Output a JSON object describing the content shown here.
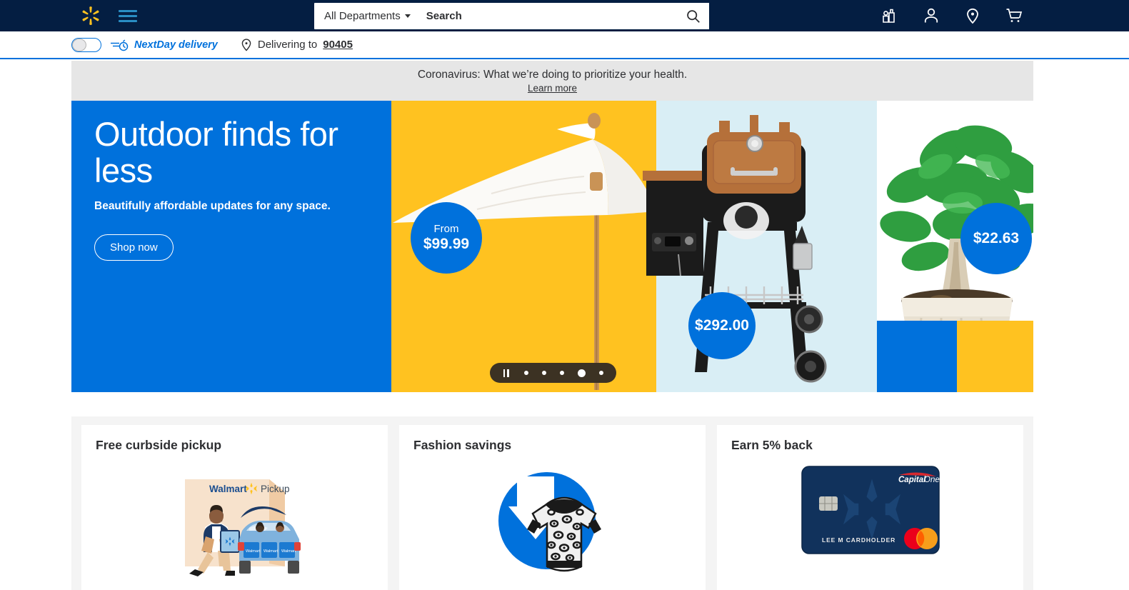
{
  "header": {
    "logo_icon": "walmart-spark-icon",
    "menu_icon": "hamburger-menu-icon",
    "search": {
      "department_label": "All Departments",
      "placeholder": "Search",
      "value": "",
      "search_icon": "search-icon"
    },
    "icons": [
      {
        "name": "grocery-icon",
        "label": "Grocery"
      },
      {
        "name": "account-icon",
        "label": "Account"
      },
      {
        "name": "location-pin-icon",
        "label": "Store location"
      },
      {
        "name": "cart-icon",
        "label": "Cart"
      }
    ]
  },
  "delivery_bar": {
    "toggle_state": "off",
    "toggle_name": "nextday-delivery-toggle",
    "nextday_label": "NextDay delivery",
    "nextday_icon": "nextday-bike-icon",
    "pin_icon": "location-pin-icon",
    "delivering_to_label": "Delivering to",
    "zip": "90405"
  },
  "covid_banner": {
    "message": "Coronavirus: What we’re doing to prioritize your health.",
    "link_label": "Learn more"
  },
  "hero": {
    "headline": "Outdoor finds for less",
    "subhead": "Beautifully affordable updates for any space.",
    "cta_label": "Shop now",
    "price_bubbles": [
      {
        "prefix": "From",
        "price": "$99.99",
        "product": "patio-umbrella"
      },
      {
        "prefix": "",
        "price": "$292.00",
        "product": "pellet-grill"
      },
      {
        "prefix": "",
        "price": "$22.63",
        "product": "potted-plant"
      }
    ],
    "carousel": {
      "pause_icon": "pause-icon",
      "slide_count": 5,
      "active_slide": 4
    },
    "colors": {
      "blue": "#0071dc",
      "yellow": "#ffc220",
      "cyan": "#d9eef5",
      "dark_navy": "#041e42"
    }
  },
  "cards": [
    {
      "title": "Free curbside pickup",
      "art": "walmart-pickup-illustration",
      "sign_brand": "Walmart",
      "sign_word": "Pickup"
    },
    {
      "title": "Fashion savings",
      "art": "leopard-sweater-illustration"
    },
    {
      "title": "Earn 5% back",
      "art": "capital-one-card-illustration",
      "card_brand": "CapitalOne",
      "cardholder_name": "LEE M CARDHOLDER",
      "network": "mastercard"
    }
  ]
}
